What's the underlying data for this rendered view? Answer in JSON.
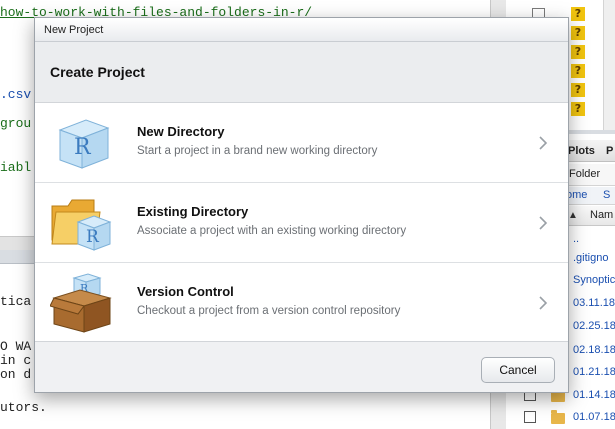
{
  "background": {
    "editor_lines": [
      {
        "text": "how-to-work-with-files-and-folders-in-r/",
        "color": "#1a6e1a"
      },
      {
        "text": ".csv",
        "color": "#1a4fb0"
      },
      {
        "text": "grou",
        "color": "#1a6e1a"
      },
      {
        "text": "iabl",
        "color": "#1a6e1a"
      }
    ],
    "console_lines": [
      "tica",
      "O WA",
      "in c",
      "on d",
      "utors."
    ],
    "right_tabs": [
      "Plots",
      "P"
    ],
    "files_toolbar_label": "Folder",
    "breadcrumb": [
      "ome",
      "S"
    ],
    "file_column_header": "Nam",
    "file_rows": [
      "..",
      ".gitigno",
      "Synoptic",
      "03.11.18",
      "02.25.18",
      "02.18.18",
      "01.21.18",
      "01.14.18",
      "01.07.18"
    ]
  },
  "modal": {
    "window_title": "New Project",
    "header": "Create Project",
    "options": [
      {
        "title": "New Directory",
        "description": "Start a project in a brand new working directory",
        "icon": "r-cube-icon"
      },
      {
        "title": "Existing Directory",
        "description": "Associate a project with an existing working directory",
        "icon": "folder-r-icon"
      },
      {
        "title": "Version Control",
        "description": "Checkout a project from a version control repository",
        "icon": "box-r-icon"
      }
    ],
    "cancel_label": "Cancel"
  },
  "colors": {
    "accent_link": "#1a4fb0",
    "question_badge": "#f1c40f"
  }
}
